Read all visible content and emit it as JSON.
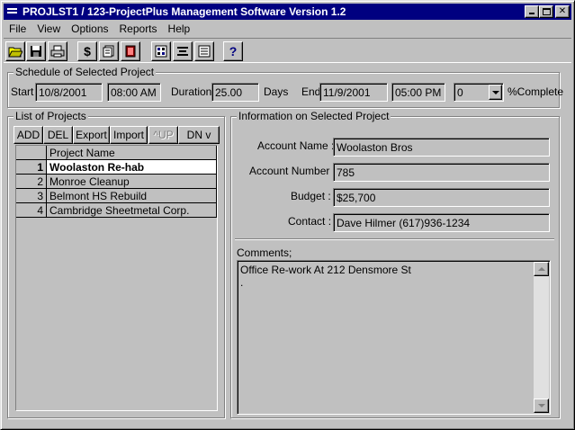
{
  "window": {
    "title": "PROJLST1  /  123-ProjectPlus Management Software Version 1.2"
  },
  "menu": [
    "File",
    "View",
    "Options",
    "Reports",
    "Help"
  ],
  "toolbar": {
    "items": [
      {
        "icon": "open-folder-icon"
      },
      {
        "icon": "save-disk-icon"
      },
      {
        "icon": "print-icon"
      },
      {
        "icon": "dollar-icon",
        "glyph": "$"
      },
      {
        "icon": "report-icon"
      },
      {
        "icon": "book-icon"
      },
      {
        "icon": "calculator-icon"
      },
      {
        "icon": "list-icon"
      },
      {
        "icon": "form-icon"
      },
      {
        "icon": "help-icon",
        "glyph": "?"
      }
    ]
  },
  "schedule": {
    "group_label": "Schedule of Selected Project",
    "start_label": "Start :",
    "start_date": "10/8/2001",
    "start_time": "08:00 AM",
    "duration_label": "Duration:",
    "duration_value": "25.00",
    "duration_unit": "Days",
    "end_label": "End",
    "end_date": "11/9/2001",
    "end_time": "05:00 PM",
    "complete_value": "0",
    "complete_label": "%Complete"
  },
  "projects": {
    "group_label": "List of Projects",
    "buttons": {
      "add": "ADD",
      "del": "DEL",
      "export": "Export",
      "import": "Import",
      "up": "^UP",
      "down": "DN v"
    },
    "column_header": "Project Name",
    "rows": [
      {
        "num": "1",
        "name": "Woolaston Re-hab",
        "selected": true
      },
      {
        "num": "2",
        "name": "Monroe Cleanup",
        "selected": false
      },
      {
        "num": "3",
        "name": "Belmont HS  Rebuild",
        "selected": false
      },
      {
        "num": "4",
        "name": "Cambridge Sheetmetal Corp.",
        "selected": false
      }
    ]
  },
  "info": {
    "group_label": "Information on Selected Project",
    "account_name_label": "Account Name :",
    "account_name": "Woolaston Bros",
    "account_number_label": "Account Number :",
    "account_number": "785",
    "budget_label": "Budget :",
    "budget": "$25,700",
    "contact_label": "Contact :",
    "contact": "Dave Hilmer (617)936-1234",
    "comments_label": "Comments;",
    "comments": "Office Re-work At 212 Densmore St\n."
  }
}
